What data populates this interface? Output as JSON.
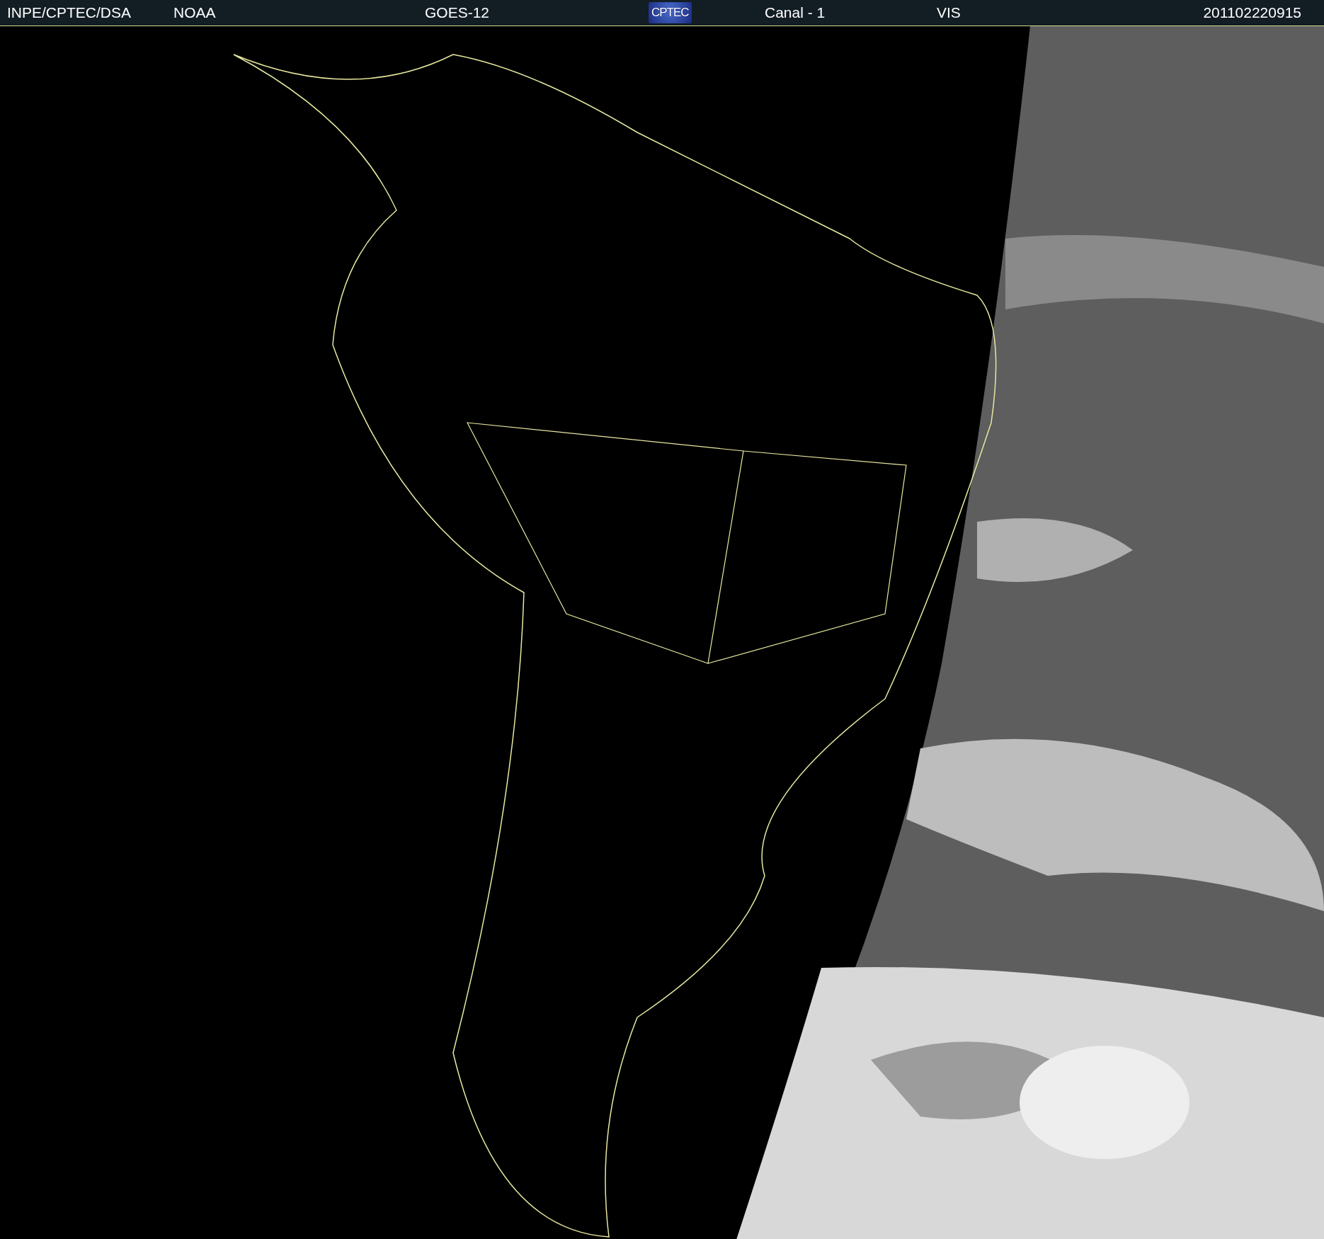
{
  "header": {
    "items": [
      {
        "kind": "text",
        "label": "INPE/CPTEC/DSA"
      },
      {
        "kind": "text",
        "label": "NOAA"
      },
      {
        "kind": "text",
        "label": "GOES-12"
      },
      {
        "kind": "logo",
        "label": "CPTEC"
      },
      {
        "kind": "text",
        "label": "Canal - 1"
      },
      {
        "kind": "text",
        "label": "VIS"
      },
      {
        "kind": "text",
        "label": "201102220915"
      }
    ]
  }
}
